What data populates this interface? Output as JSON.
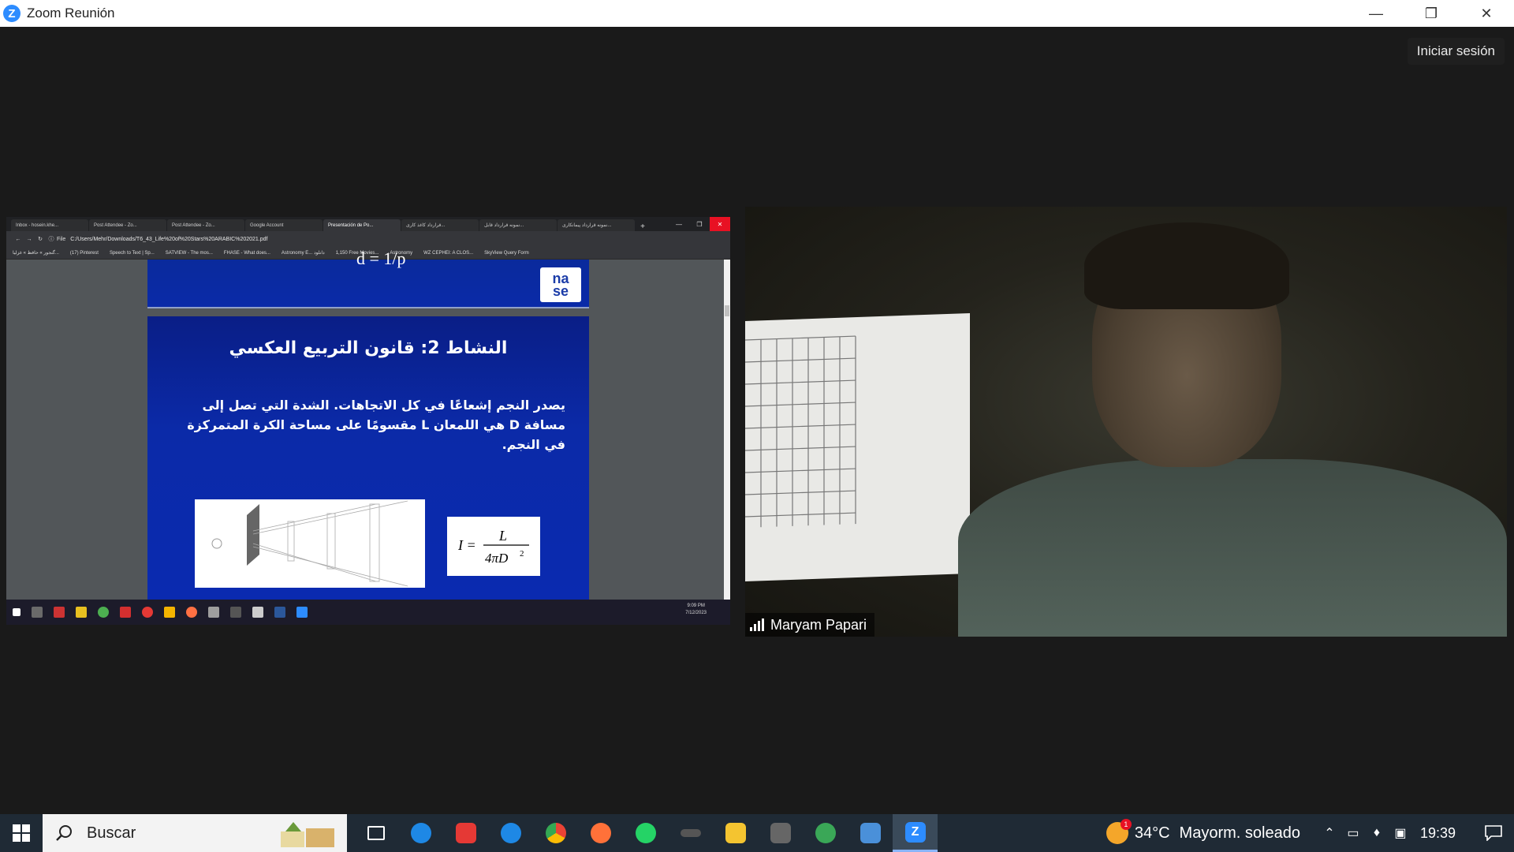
{
  "app": {
    "title": "Zoom Reunión",
    "signin_label": "Iniciar sesión",
    "accent": "#2d8cff"
  },
  "shared_screen": {
    "browser": {
      "tabs": [
        {
          "label": "Inbox - hosein.khe..."
        },
        {
          "label": "Post Attendee - Zo..."
        },
        {
          "label": "Post Attendee - Zo..."
        },
        {
          "label": "Google Account"
        },
        {
          "label": "Presentación de Po..."
        },
        {
          "label": "قرارداد کاغذ کاری..."
        },
        {
          "label": "نمونه قرارداد قابل..."
        },
        {
          "label": "نمونه قرارداد پیمانکاری..."
        }
      ],
      "address_prefix": "File",
      "address": "C:/Users/Mehr/Downloads/T6_43_Life%20of%20Stars%20ARABIC%202021.pdf",
      "bookmarks": [
        "گنجور » حافظ » غزلیا...",
        "(17) Pinterest",
        "Speech to Text | Sp...",
        "SATVIEW - The mos...",
        "FHASE - What does...",
        "Astronomy E... دانلود",
        "1,150 Free Movies...",
        "Astronomy",
        "WZ CEPHEI: A CLOS...",
        "SkyView Query Form"
      ]
    },
    "slide_prev": {
      "formula": "d = 1/p",
      "logo_text_1": "na",
      "logo_text_2": "se"
    },
    "slide": {
      "title": "النشاط 2: قانون التربيع العكسي",
      "body": "يصدر النجم إشعاعًا في كل الاتجاهات. الشدة التي تصل إلى مسافة D هي اللمعان L مقسومًا على مساحة الكرة المتمركزة في النجم.",
      "formula_lhs": "I =",
      "formula_num": "L",
      "formula_den": "4πD",
      "formula_exp": "2"
    },
    "mini_clock": {
      "time": "9:09 PM",
      "date": "7/12/2023"
    }
  },
  "video": {
    "participant_name": "Maryam Papari"
  },
  "taskbar": {
    "search_placeholder": "Buscar",
    "weather_temp": "34°C",
    "weather_text": "Mayorm. soleado",
    "weather_badge": "1",
    "clock": "19:39",
    "icons": [
      "task-view-icon",
      "edge-icon",
      "app-icon",
      "teamviewer-icon",
      "chrome-icon",
      "firefox-icon",
      "whatsapp-icon",
      "app-icon",
      "file-explorer-icon",
      "app-icon",
      "app-icon",
      "app-icon",
      "zoom-icon"
    ]
  }
}
